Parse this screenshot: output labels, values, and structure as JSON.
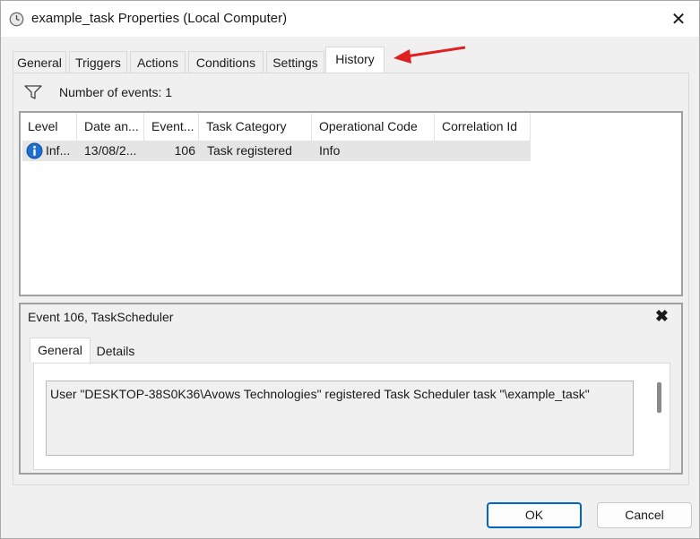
{
  "window": {
    "title": "example_task Properties (Local Computer)",
    "close_glyph": "✕"
  },
  "tabs": [
    {
      "label": "General"
    },
    {
      "label": "Triggers"
    },
    {
      "label": "Actions"
    },
    {
      "label": "Conditions"
    },
    {
      "label": "Settings"
    },
    {
      "label": "History",
      "active": true
    }
  ],
  "history": {
    "events_label": "Number of events: 1",
    "columns": [
      "Level",
      "Date an...",
      "Event...",
      "Task Category",
      "Operational Code",
      "Correlation Id"
    ],
    "rows": [
      {
        "level": "Inf...",
        "date": "13/08/2...",
        "event": "106",
        "task_category": "Task registered",
        "operational_code": "Info",
        "correlation_id": ""
      }
    ]
  },
  "detail": {
    "title": "Event 106, TaskScheduler",
    "close_glyph": "✖",
    "tabs": [
      {
        "label": "General",
        "active": true
      },
      {
        "label": "Details"
      }
    ],
    "message": "User \"DESKTOP-38S0K36\\Avows Technologies\"  registered Task Scheduler task \"\\example_task\""
  },
  "buttons": {
    "ok": "OK",
    "cancel": "Cancel"
  },
  "colors": {
    "accent": "#0067c0",
    "annotation_arrow": "#e02020",
    "info_icon": "#1e6fd0"
  },
  "icons": {
    "title": "clock-icon",
    "filter": "filter-icon",
    "level": "info-icon",
    "annotation": "red-arrow-icon"
  }
}
